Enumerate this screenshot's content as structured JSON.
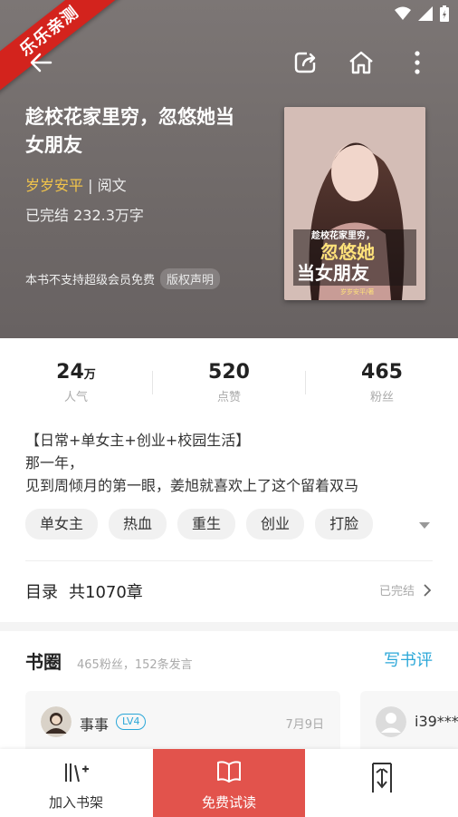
{
  "watermark": "乐乐亲测",
  "book": {
    "title": "趁校花家里穷，忽悠她当女朋友",
    "author": "岁岁安平",
    "publisher": "| 阅文",
    "status_words": "已完结 232.3万字",
    "notice": "本书不支持超级会员免费",
    "copyright_label": "版权声明",
    "cover": {
      "title_top": "趁校花家里穷，",
      "title_main1": "忽悠她",
      "title_main2": "当女朋友",
      "author_tag": "岁岁安平/著"
    }
  },
  "stats": [
    {
      "value": "24",
      "unit": "万",
      "label": "人气"
    },
    {
      "value": "520",
      "unit": "",
      "label": "点赞"
    },
    {
      "value": "465",
      "unit": "",
      "label": "粉丝"
    }
  ],
  "description": {
    "line1": "【日常+单女主+创业+校园生活】",
    "line2": "那一年，",
    "line3": "见到周倾月的第一眼，姜旭就喜欢上了这个留着双马"
  },
  "tags": [
    "单女主",
    "热血",
    "重生",
    "创业",
    "打脸"
  ],
  "toc": {
    "label": "目录",
    "count": "共1070章",
    "status": "已完结"
  },
  "circle": {
    "title": "书圈",
    "subtitle": "465粉丝，152条发言",
    "write_review": "写书评",
    "cards": [
      {
        "user": "事事",
        "level": "LV4",
        "date": "7月9日"
      },
      {
        "user": "i39****"
      }
    ]
  },
  "bottombar": {
    "shelf": "加入书架",
    "read": "免费试读"
  },
  "colors": {
    "accent_read": "#e2534c",
    "link": "#2ba7d8",
    "author": "#f2c44a"
  }
}
